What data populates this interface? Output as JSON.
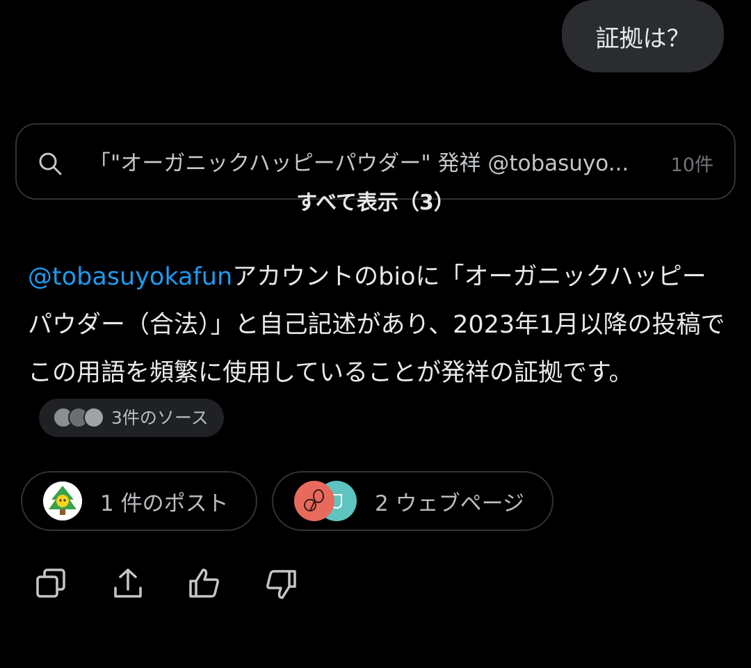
{
  "user_message": "証拠は？",
  "search": {
    "query": "「\"オーガニックハッピーパウダー\" 発祥 @tobasuyo...",
    "count": "10件",
    "show_all": "すべて表示（3）"
  },
  "answer": {
    "mention": "@tobasuyokafun",
    "text": "アカウントのbioに「オーガニックハッピーパウダー（合法）」と自己記述があり、2023年1月以降の投稿でこの用語を頻繁に使用していることが発祥の証拠です。",
    "sources_label": "3件のソース"
  },
  "chips": {
    "posts_label": "1 件のポスト",
    "web_label": "2 ウェブページ"
  },
  "actions": {
    "icons": [
      "copy-icon",
      "share-icon",
      "thumbs-up-icon",
      "thumbs-down-icon"
    ]
  },
  "colors": {
    "background": "#000000",
    "mention": "#1d9bf0",
    "bubble": "#2a2c30",
    "border": "#2f3336"
  }
}
